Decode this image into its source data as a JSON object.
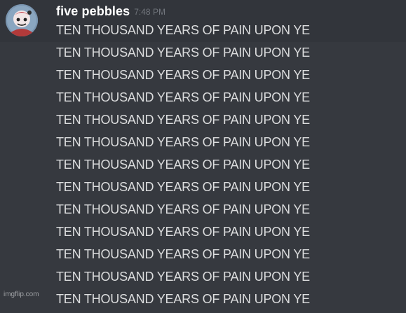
{
  "message": {
    "author": "five pebbles",
    "timestamp": "7:48 PM",
    "avatar_icon": "character-avatar",
    "lines": [
      "TEN THOUSAND YEARS OF PAIN UPON YE",
      "TEN THOUSAND YEARS OF PAIN UPON YE",
      "TEN THOUSAND YEARS OF PAIN UPON YE",
      "TEN THOUSAND YEARS OF PAIN UPON YE",
      "TEN THOUSAND YEARS OF PAIN UPON YE",
      "TEN THOUSAND YEARS OF PAIN UPON YE",
      "TEN THOUSAND YEARS OF PAIN UPON YE",
      "TEN THOUSAND YEARS OF PAIN UPON YE",
      "TEN THOUSAND YEARS OF PAIN UPON YE",
      "TEN THOUSAND YEARS OF PAIN UPON YE",
      "TEN THOUSAND YEARS OF PAIN UPON YE",
      "TEN THOUSAND YEARS OF PAIN UPON YE",
      "TEN THOUSAND YEARS OF PAIN UPON YE"
    ]
  },
  "watermark": "imgflip.com",
  "colors": {
    "background": "#36393f",
    "author": "#ffffff",
    "timestamp": "#72767d",
    "text": "#dcddde"
  }
}
